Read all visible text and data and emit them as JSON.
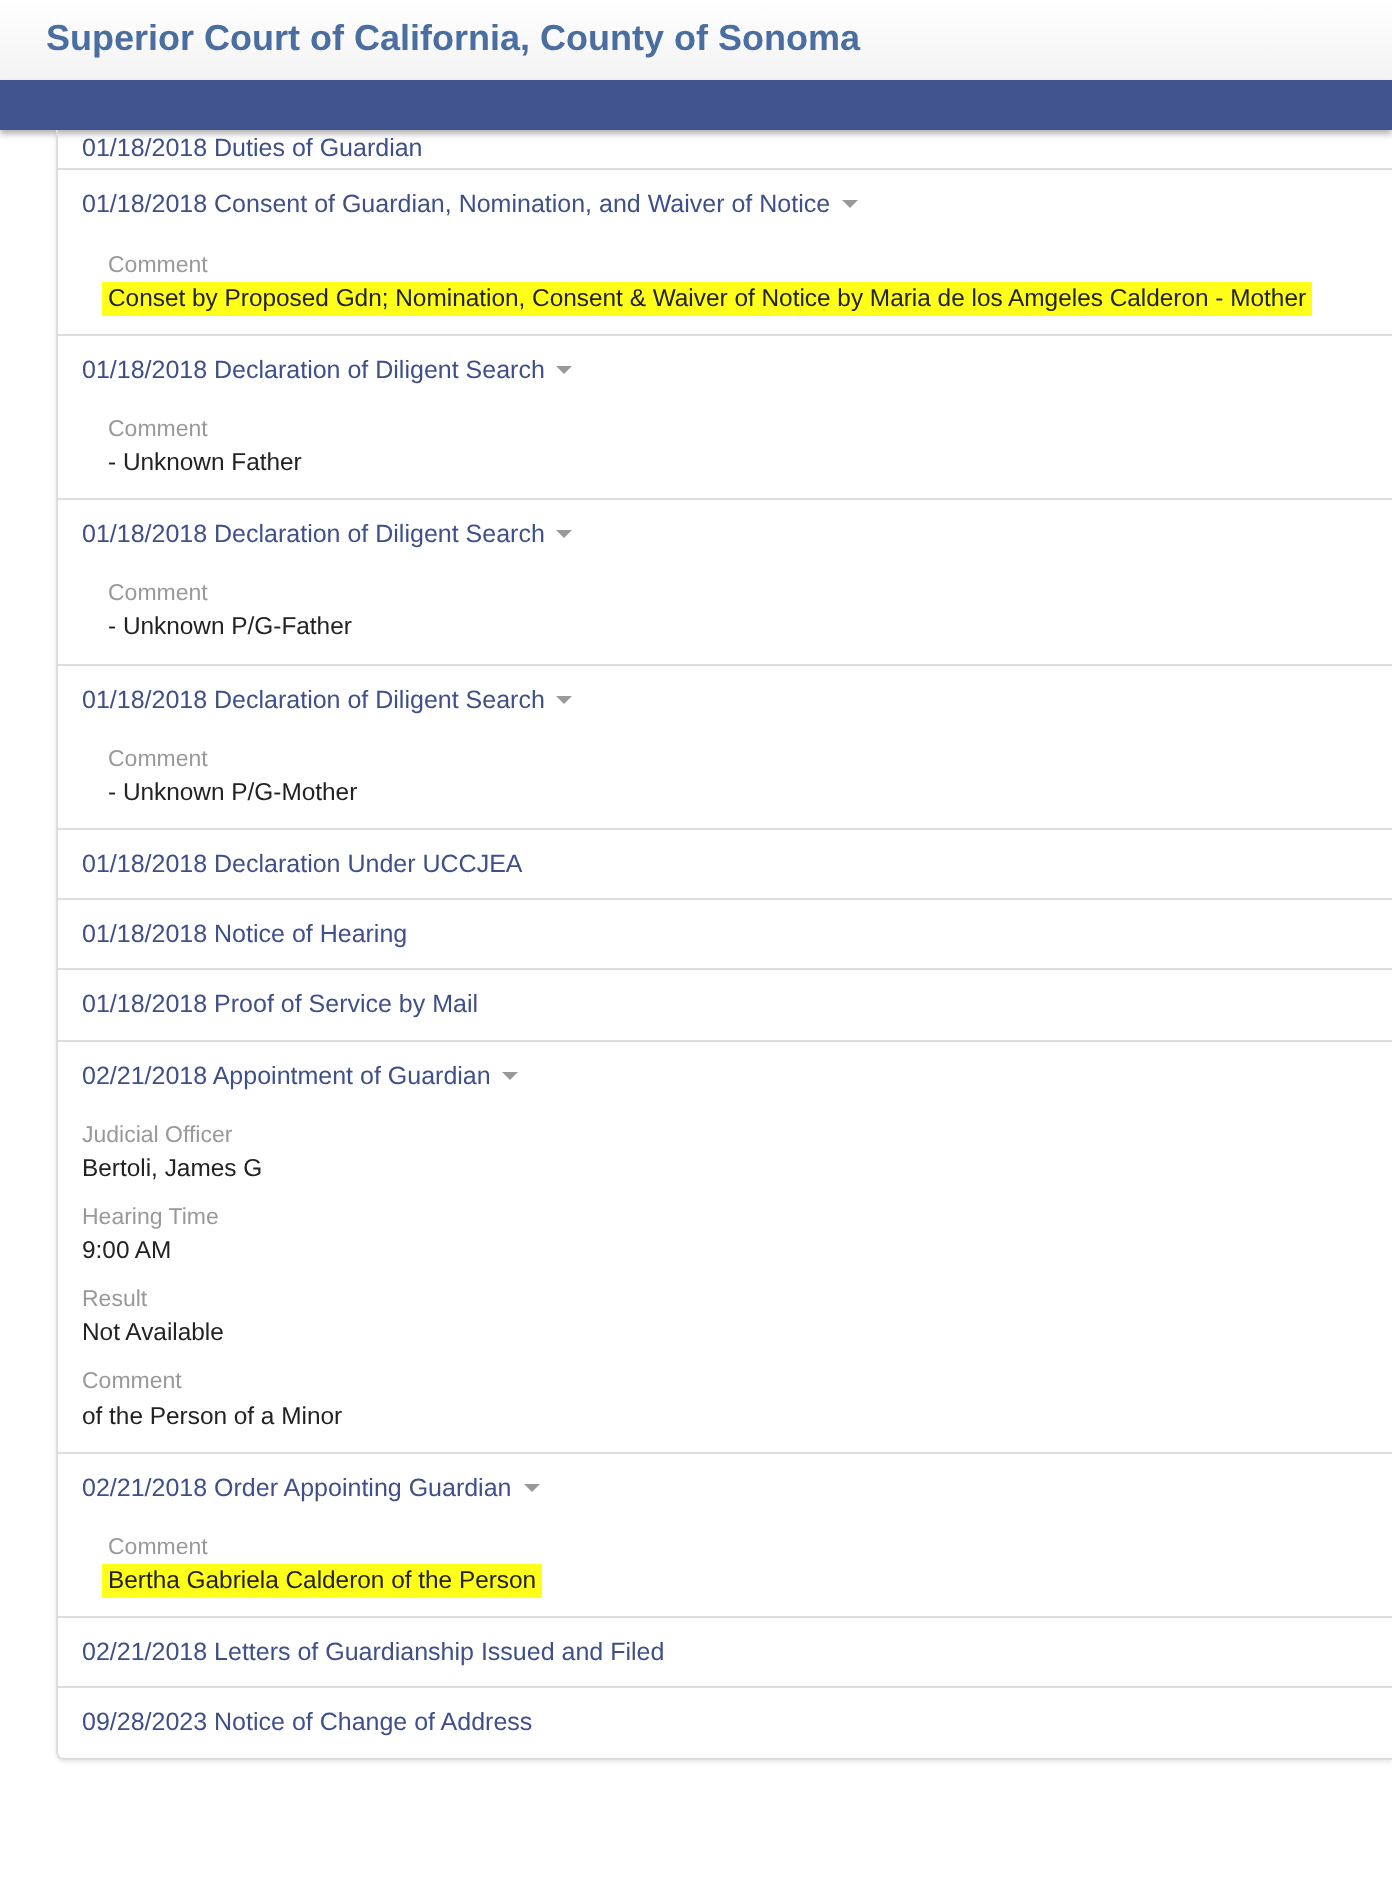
{
  "header": {
    "title": "Superior Court of California, County of Sonoma"
  },
  "events": [
    {
      "label": "01/18/2018 Duties of Guardian",
      "kind": "simple",
      "has_menu": false
    },
    {
      "label": "01/18/2018 Consent of Guardian, Nomination, and Waiver of Notice",
      "kind": "comment",
      "has_menu": true,
      "details": [
        {
          "label": "Comment",
          "value": "Conset by Proposed Gdn; Nomination, Consent & Waiver of Notice by Maria de los Amgeles Calderon - Mother",
          "highlighted": true
        }
      ]
    },
    {
      "label": "01/18/2018 Declaration of Diligent Search",
      "kind": "comment",
      "has_menu": true,
      "details": [
        {
          "label": "Comment",
          "value": "- Unknown Father",
          "highlighted": false
        }
      ]
    },
    {
      "label": "01/18/2018 Declaration of Diligent Search",
      "kind": "comment",
      "has_menu": true,
      "details": [
        {
          "label": "Comment",
          "value": "- Unknown P/G-Father",
          "highlighted": false
        }
      ]
    },
    {
      "label": "01/18/2018 Declaration of Diligent Search",
      "kind": "comment",
      "has_menu": true,
      "details": [
        {
          "label": "Comment",
          "value": "- Unknown P/G-Mother",
          "highlighted": false
        }
      ]
    },
    {
      "label": "01/18/2018 Declaration Under UCCJEA",
      "kind": "simple",
      "has_menu": false
    },
    {
      "label": "01/18/2018 Notice of Hearing",
      "kind": "simple",
      "has_menu": false
    },
    {
      "label": "01/18/2018 Proof of Service by Mail",
      "kind": "simple",
      "has_menu": false
    },
    {
      "label": "02/21/2018 Appointment of Guardian",
      "kind": "hearing",
      "has_menu": true,
      "details": [
        {
          "label": "Judicial Officer",
          "value": "Bertoli, James G",
          "highlighted": false
        },
        {
          "label": "Hearing Time",
          "value": "9:00 AM",
          "highlighted": false
        },
        {
          "label": "Result",
          "value": "Not Available",
          "highlighted": false
        },
        {
          "label": "Comment",
          "value": "of the Person of a Minor",
          "highlighted": false
        }
      ]
    },
    {
      "label": "02/21/2018 Order Appointing Guardian",
      "kind": "comment",
      "has_menu": true,
      "details": [
        {
          "label": "Comment",
          "value": "Bertha Gabriela Calderon of the Person",
          "highlighted": true
        }
      ]
    },
    {
      "label": "02/21/2018 Letters of Guardianship Issued and Filed",
      "kind": "simple",
      "has_menu": false
    },
    {
      "label": "09/28/2023 Notice of Change of Address",
      "kind": "simple",
      "has_menu": false
    }
  ]
}
